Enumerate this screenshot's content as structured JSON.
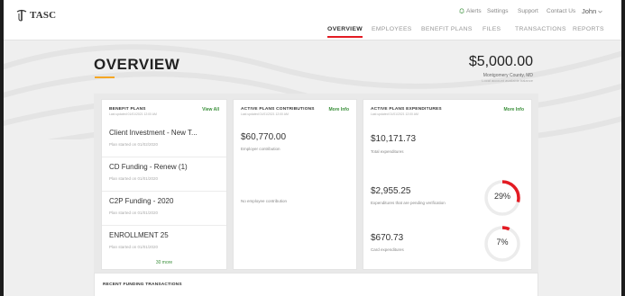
{
  "app": {
    "logo_text": "TASC"
  },
  "util_links": {
    "alerts": "Alerts",
    "settings": "Settings",
    "support": "Support",
    "contact": "Contact Us",
    "user": "John"
  },
  "nav_tabs": [
    {
      "label": "OVERVIEW",
      "active": true
    },
    {
      "label": "EMPLOYEES",
      "active": false
    },
    {
      "label": "BENEFIT PLANS",
      "active": false
    },
    {
      "label": "FILES",
      "active": false
    },
    {
      "label": "TRANSACTIONS",
      "active": false
    },
    {
      "label": "REPORTS",
      "active": false
    }
  ],
  "page": {
    "title": "OVERVIEW",
    "balance": "$5,000.00",
    "location": "Montgomery County, MD",
    "balance_note": "Local account available balance"
  },
  "benefit_plans": {
    "title": "BENEFIT PLANS",
    "updated": "Last updated 01/01/2021 12:00 AM",
    "link": "View All",
    "items": [
      {
        "name": "Client Investment - New T...",
        "date": "Plan started on 01/02/2020"
      },
      {
        "name": "CD Funding - Renew (1)",
        "date": "Plan started on 01/01/2020"
      },
      {
        "name": "C2P Funding - 2020",
        "date": "Plan started on 01/01/2020"
      },
      {
        "name": "ENROLLMENT 25",
        "date": "Plan started on 01/01/2020"
      }
    ],
    "more": "30 more"
  },
  "contributions": {
    "title": "ACTIVE PLANS CONTRIBUTIONS",
    "updated": "Last updated 01/01/2021 12:00 AM",
    "link": "More Info",
    "amount": "$60,770.00",
    "amount_label": "Employer contribution",
    "empty_text": "No employee contribution"
  },
  "expenditures": {
    "title": "ACTIVE PLANS EXPENDITURES",
    "updated": "Last updated 01/01/2021 12:00 AM",
    "link": "More Info",
    "total": {
      "amount": "$10,171.73",
      "label": "Total expenditures"
    },
    "pending": {
      "amount": "$2,955.25",
      "label": "Expenditures that are pending verification",
      "percent": "29%",
      "fraction": 0.29
    },
    "card": {
      "amount": "$670.73",
      "label": "Card expenditures",
      "percent": "7%",
      "fraction": 0.07
    }
  },
  "recent": {
    "title": "RECENT FUNDING TRANSACTIONS"
  },
  "colors": {
    "accent": "#e31b23",
    "link": "#3a8f3a",
    "title_accent": "#f5a623",
    "ring_track": "#ececec"
  }
}
